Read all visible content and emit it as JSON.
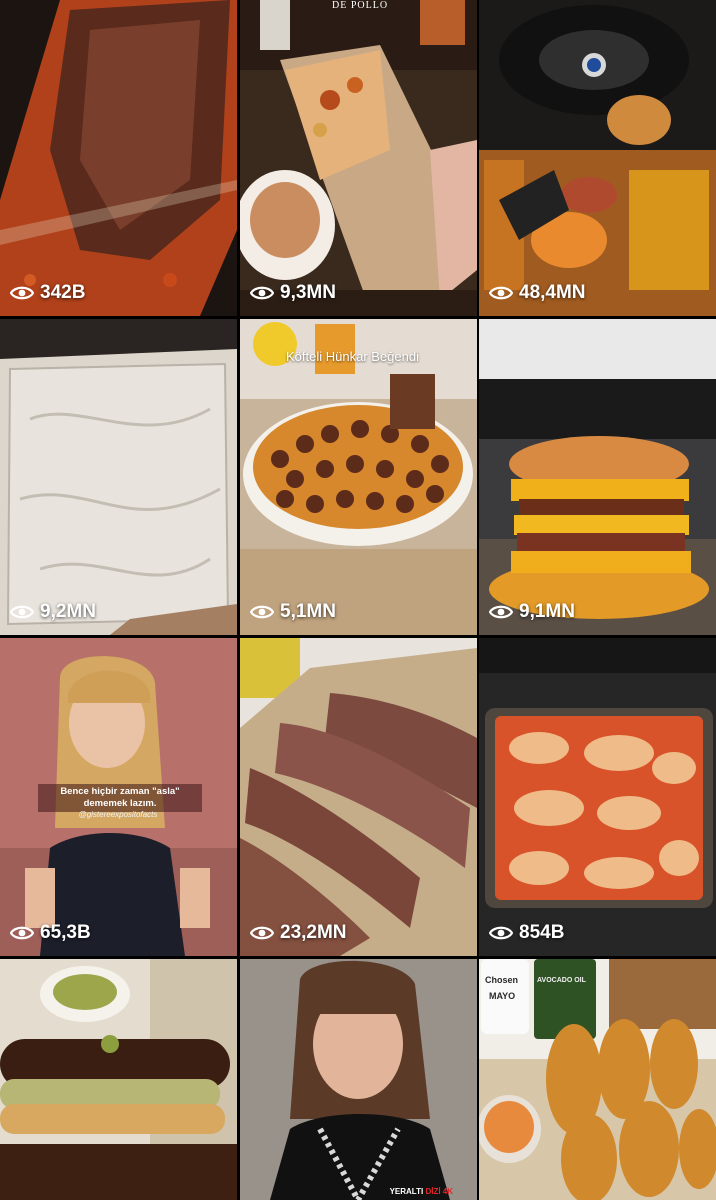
{
  "tiles": [
    {
      "name": "tile-1",
      "views": "342B",
      "image": "lahmacun-with-pulled-meat"
    },
    {
      "name": "tile-2",
      "views": "9,3MN",
      "image": "chicken-wrap-in-hand",
      "brand": "DE POLLO"
    },
    {
      "name": "tile-3",
      "views": "48,4MN",
      "image": "fast-food-feast-in-car"
    },
    {
      "name": "tile-4",
      "views": "9,2MN",
      "image": "phyllo-dough-in-tray"
    },
    {
      "name": "tile-5",
      "views": "5,1MN",
      "image": "meatball-casserole",
      "title": "Köfteli Hünkar Beğendi"
    },
    {
      "name": "tile-6",
      "views": "9,1MN",
      "image": "stacked-cheese-burger"
    },
    {
      "name": "tile-7",
      "views": "65,3B",
      "image": "woman-speaking",
      "caption": "Bence hiçbir zaman \"asla\" dememek lazım.",
      "handle": "@gistereexpositofacts"
    },
    {
      "name": "tile-8",
      "views": "23,2MN",
      "image": "doner-meat-slabs"
    },
    {
      "name": "tile-9",
      "views": "854B",
      "image": "lasagna-in-glass-dish"
    },
    {
      "name": "tile-10",
      "views": "",
      "image": "pistachio-chocolate-eclairs"
    },
    {
      "name": "tile-11",
      "views": "",
      "image": "actress-scene",
      "watermark_a": "YERALTI",
      "watermark_b": "DİZİ 4K"
    },
    {
      "name": "tile-12",
      "views": "",
      "image": "hasselback-potatoes",
      "labels": [
        "Chosen",
        "MAYO",
        "AVOCADO OIL"
      ]
    }
  ]
}
